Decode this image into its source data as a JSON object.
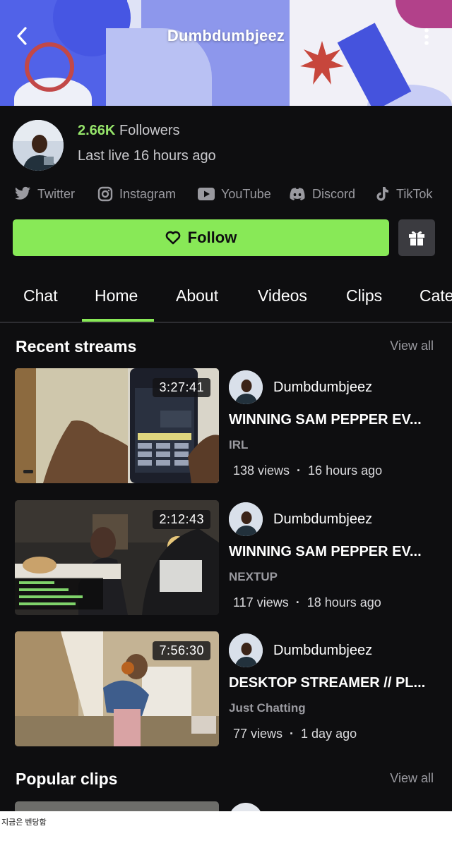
{
  "header": {
    "title": "Dumbdumbjeez",
    "back_icon": "chevron-left-icon",
    "menu_icon": "more-vertical-icon"
  },
  "profile": {
    "followers_count": "2.66K",
    "followers_label": "Followers",
    "last_live": "Last live 16 hours ago",
    "socials": [
      {
        "label": "Twitter",
        "icon": "twitter-icon"
      },
      {
        "label": "Instagram",
        "icon": "instagram-icon"
      },
      {
        "label": "YouTube",
        "icon": "youtube-icon"
      },
      {
        "label": "Discord",
        "icon": "discord-icon"
      },
      {
        "label": "TikTok",
        "icon": "tiktok-icon"
      }
    ],
    "follow_label": "Follow",
    "gift_icon": "gift-icon"
  },
  "tabs": [
    {
      "label": "Chat"
    },
    {
      "label": "Home",
      "selected": true
    },
    {
      "label": "About"
    },
    {
      "label": "Videos"
    },
    {
      "label": "Clips"
    },
    {
      "label": "Categories"
    }
  ],
  "recent_streams": {
    "title": "Recent streams",
    "view_all": "View all",
    "items": [
      {
        "duration": "3:27:41",
        "channel": "Dumbdumbjeez",
        "title": "WINNING SAM PEPPER EV...",
        "category": "IRL",
        "views": "138 views",
        "age": "16 hours ago"
      },
      {
        "duration": "2:12:43",
        "channel": "Dumbdumbjeez",
        "title": "WINNING SAM PEPPER EV...",
        "category": "NEXTUP",
        "views": "117 views",
        "age": "18 hours ago"
      },
      {
        "duration": "7:56:30",
        "channel": "Dumbdumbjeez",
        "title": "DESKTOP STREAMER // PL...",
        "category": "Just Chatting",
        "views": "77 views",
        "age": "1 day ago"
      }
    ]
  },
  "popular_clips": {
    "title": "Popular clips",
    "view_all": "View all"
  },
  "caption": "지금은 벤당함",
  "colors": {
    "accent": "#88e957",
    "followers": "#95e36a",
    "background": "#0e0e10",
    "muted": "#9a9aa0"
  }
}
